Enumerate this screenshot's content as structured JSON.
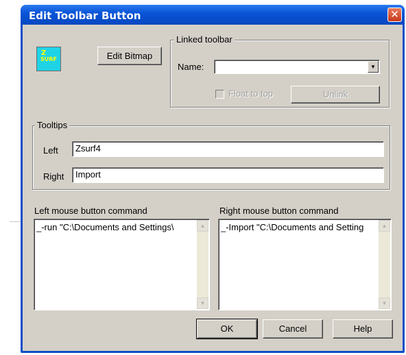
{
  "window": {
    "title": "Edit Toolbar Button"
  },
  "icon": {
    "name": "zsurf-bitmap-icon",
    "line1": "Z",
    "line2": "SURF",
    "bg": "#1fd3e6",
    "fg": "#ffff00"
  },
  "buttons": {
    "edit_bitmap": "Edit Bitmap",
    "unlink": "Unlink",
    "ok": "OK",
    "cancel": "Cancel",
    "help": "Help"
  },
  "linked_toolbar": {
    "group_label": "Linked toolbar",
    "name_label": "Name:",
    "name_value": "",
    "float_to_top_label": "Float to top",
    "float_to_top_checked": false
  },
  "tooltips": {
    "group_label": "Tooltips",
    "left_label": "Left",
    "left_value": "Zsurf4",
    "right_label": "Right",
    "right_value": "Import"
  },
  "commands": {
    "left_label": "Left mouse button command",
    "left_value": "_-run \"C:\\Documents and Settings\\",
    "right_label": "Right mouse button command",
    "right_value": "_-Import \"C:\\Documents and Setting"
  },
  "colors": {
    "title_bar": "#0a55d8",
    "dialog_face": "#d4d0c8",
    "close": "#c8381b"
  }
}
